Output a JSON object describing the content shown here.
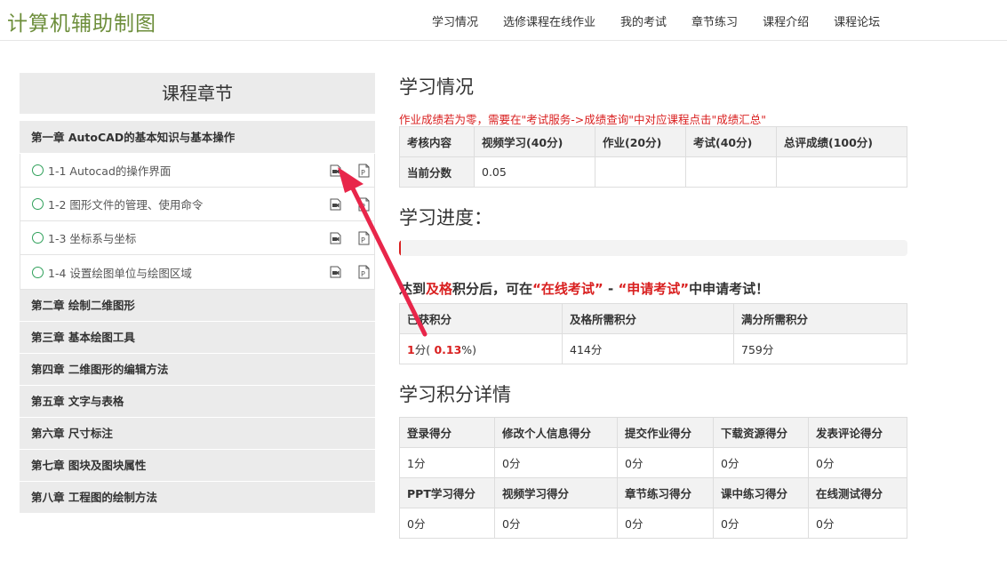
{
  "header": {
    "logo": "计算机辅助制图",
    "nav": [
      "学习情况",
      "选修课程在线作业",
      "我的考试",
      "章节练习",
      "课程介绍",
      "课程论坛"
    ]
  },
  "sidebar": {
    "title": "课程章节",
    "chapter1": "第一章 AutoCAD的基本知识与基本操作",
    "lessons": [
      {
        "label": "1-1 Autocad的操作界面",
        "video_icon": "video-icon",
        "ppt_icon": "ppt-icon"
      },
      {
        "label": "1-2 图形文件的管理、使用命令",
        "video_icon": "video-icon",
        "ppt_icon": "ppt-icon"
      },
      {
        "label": "1-3 坐标系与坐标",
        "video_icon": "video-icon",
        "ppt_icon": "ppt-icon"
      },
      {
        "label": "1-4 设置绘图单位与绘图区域",
        "video_icon": "video-icon",
        "ppt_icon": "ppt-icon"
      }
    ],
    "chapters": [
      "第二章 绘制二维图形",
      "第三章 基本绘图工具",
      "第四章 二维图形的编辑方法",
      "第五章 文字与表格",
      "第六章 尺寸标注",
      "第七章 图块及图块属性",
      "第八章 工程图的绘制方法"
    ]
  },
  "study": {
    "title": "学习情况",
    "note": "作业成绩若为零，需要在\"考试服务->成绩查询\"中对应课程点击\"成绩汇总\"",
    "headers": [
      "考核内容",
      "视频学习(40分)",
      "作业(20分)",
      "考试(40分)",
      "总评成绩(100分)"
    ],
    "row": [
      "当前分数",
      "0.05",
      "",
      "",
      ""
    ]
  },
  "progress": {
    "title": "学习进度：",
    "fraction": 0.0013
  },
  "notice": {
    "p1": "达到",
    "p2": "及格",
    "p3": "积分后，可在",
    "p4": "“在线考试”",
    "p5": " - ",
    "p6": "“申请考试”",
    "p7": "中申请考试！"
  },
  "points": {
    "headers": [
      "已获积分",
      "及格所需积分",
      "满分所需积分"
    ],
    "earned_value": "1",
    "earned_unit": "分(",
    "earned_percent": " 0.13",
    "earned_suffix": "%)",
    "pass_required": "414分",
    "full_required": "759分"
  },
  "detail": {
    "title": "学习积分详情",
    "headers1": [
      "登录得分",
      "修改个人信息得分",
      "提交作业得分",
      "下载资源得分",
      "发表评论得分"
    ],
    "values1": [
      "1分",
      "0分",
      "0分",
      "0分",
      "0分"
    ],
    "headers2": [
      "PPT学习得分",
      "视频学习得分",
      "章节练习得分",
      "课中练习得分",
      "在线测试得分"
    ],
    "values2": [
      "0分",
      "0分",
      "0分",
      "0分",
      "0分"
    ]
  },
  "colors": {
    "accent_green": "#6d8e3b",
    "alert_red": "#d92020",
    "annotation_arrow": "#e8264a"
  }
}
